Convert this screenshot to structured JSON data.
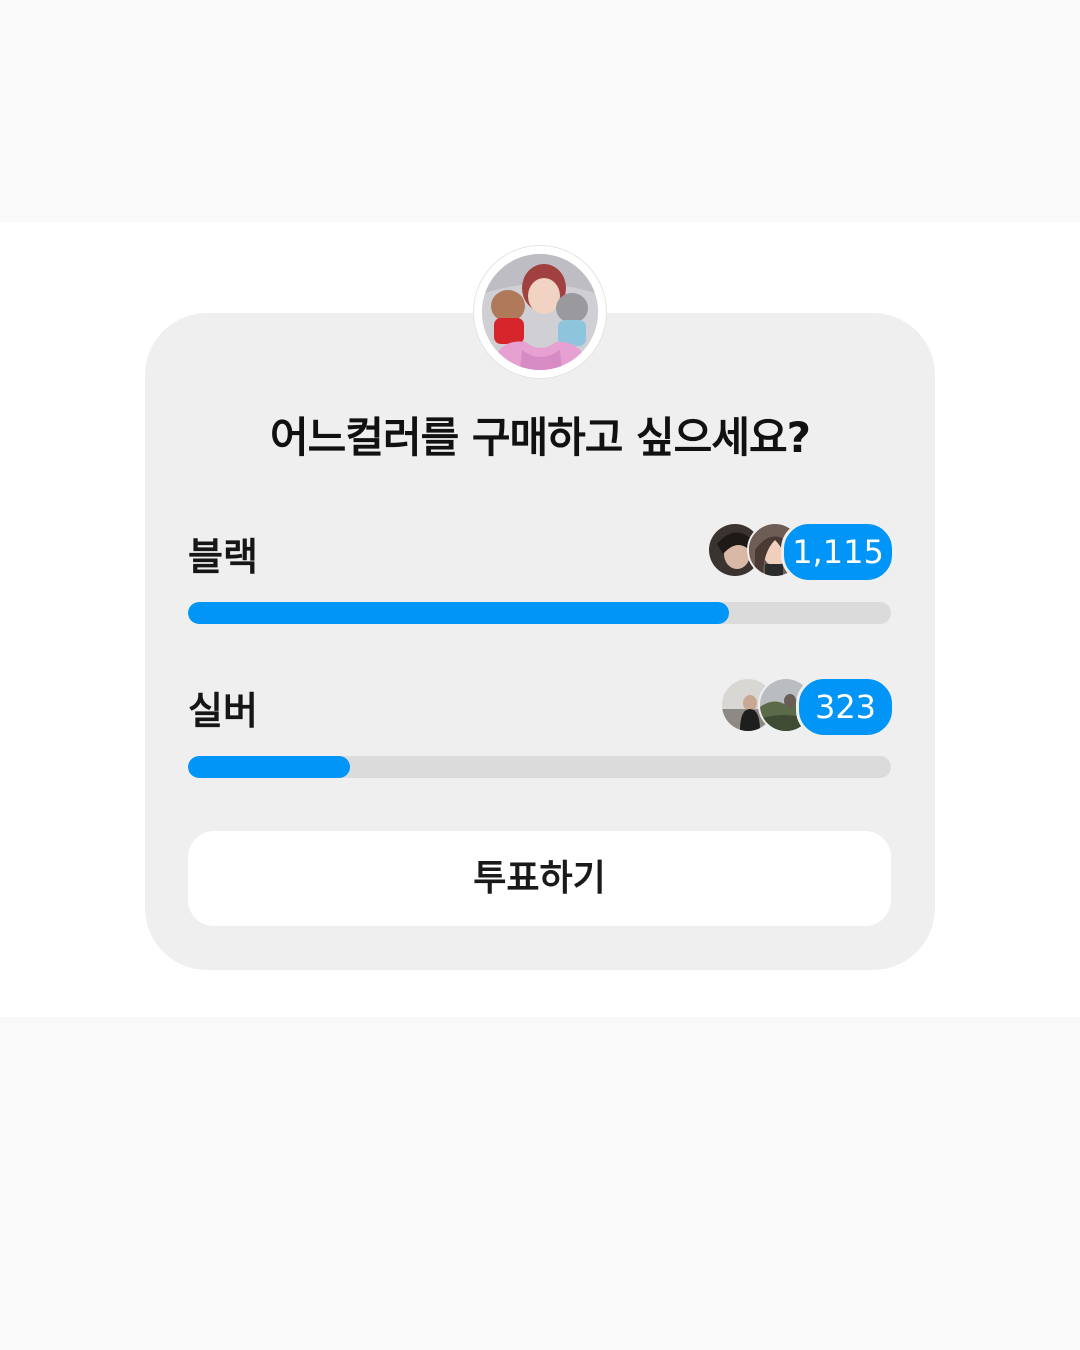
{
  "poll": {
    "question": "어느컬러를 구매하고 싶으세요?",
    "accent_color": "#0095f6",
    "options": [
      {
        "label": "블랙",
        "votes": "1,115",
        "vote_count": 1115,
        "fraction": 0.77
      },
      {
        "label": "실버",
        "votes": "323",
        "vote_count": 323,
        "fraction": 0.23
      }
    ],
    "vote_button_label": "투표하기"
  }
}
